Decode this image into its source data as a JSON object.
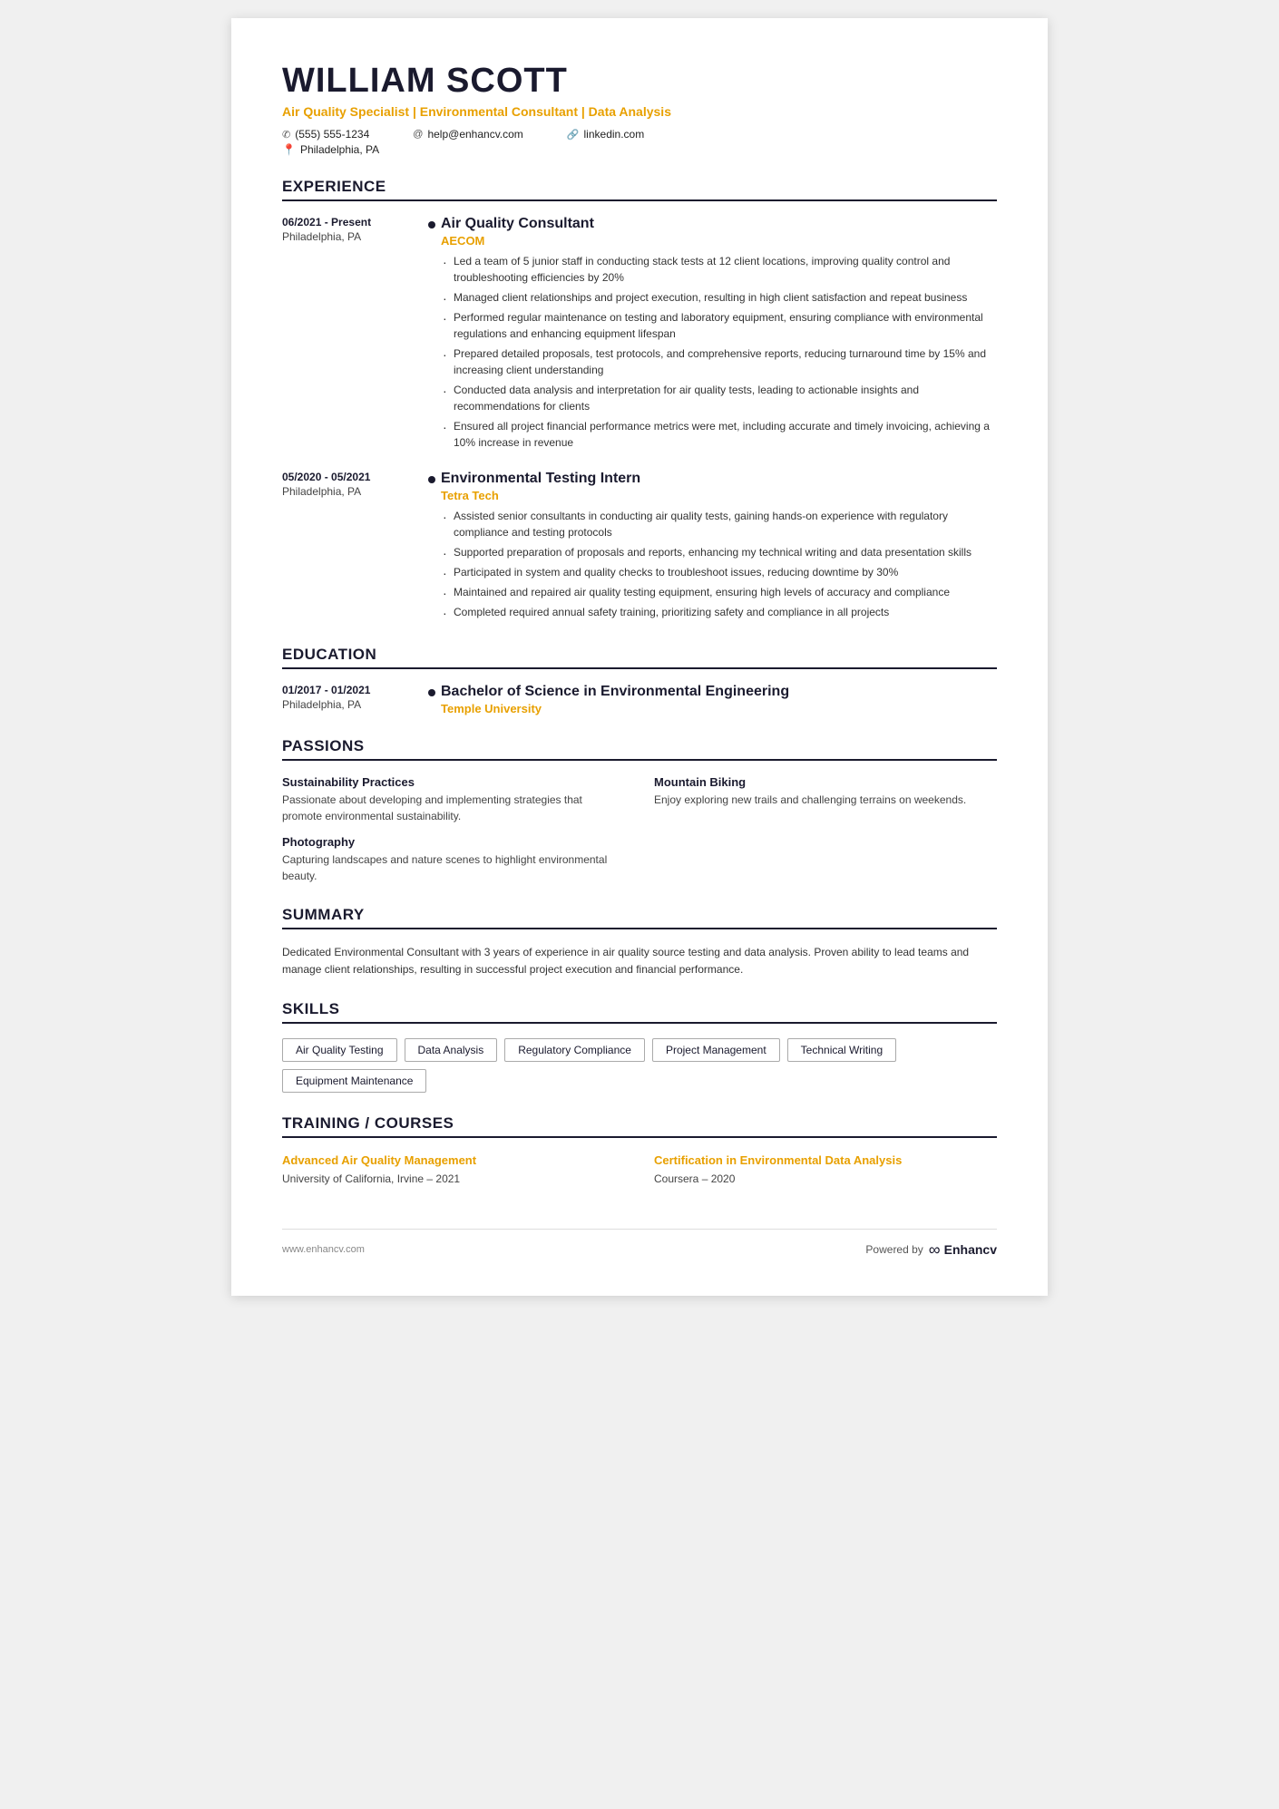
{
  "header": {
    "name": "WILLIAM SCOTT",
    "title": "Air Quality Specialist | Environmental Consultant | Data Analysis",
    "phone": "(555) 555-1234",
    "email": "help@enhancv.com",
    "linkedin": "linkedin.com",
    "location": "Philadelphia, PA"
  },
  "sections": {
    "experience": {
      "label": "EXPERIENCE",
      "jobs": [
        {
          "dates": "06/2021 - Present",
          "location": "Philadelphia, PA",
          "title": "Air Quality Consultant",
          "company": "AECOM",
          "bullets": [
            "Led a team of 5 junior staff in conducting stack tests at 12 client locations, improving quality control and troubleshooting efficiencies by 20%",
            "Managed client relationships and project execution, resulting in high client satisfaction and repeat business",
            "Performed regular maintenance on testing and laboratory equipment, ensuring compliance with environmental regulations and enhancing equipment lifespan",
            "Prepared detailed proposals, test protocols, and comprehensive reports, reducing turnaround time by 15% and increasing client understanding",
            "Conducted data analysis and interpretation for air quality tests, leading to actionable insights and recommendations for clients",
            "Ensured all project financial performance metrics were met, including accurate and timely invoicing, achieving a 10% increase in revenue"
          ]
        },
        {
          "dates": "05/2020 - 05/2021",
          "location": "Philadelphia, PA",
          "title": "Environmental Testing Intern",
          "company": "Tetra Tech",
          "bullets": [
            "Assisted senior consultants in conducting air quality tests, gaining hands-on experience with regulatory compliance and testing protocols",
            "Supported preparation of proposals and reports, enhancing my technical writing and data presentation skills",
            "Participated in system and quality checks to troubleshoot issues, reducing downtime by 30%",
            "Maintained and repaired air quality testing equipment, ensuring high levels of accuracy and compliance",
            "Completed required annual safety training, prioritizing safety and compliance in all projects"
          ]
        }
      ]
    },
    "education": {
      "label": "EDUCATION",
      "entries": [
        {
          "dates": "01/2017 - 01/2021",
          "location": "Philadelphia, PA",
          "degree": "Bachelor of Science in Environmental Engineering",
          "school": "Temple University"
        }
      ]
    },
    "passions": {
      "label": "PASSIONS",
      "items": [
        {
          "name": "Sustainability Practices",
          "desc": "Passionate about developing and implementing strategies that promote environmental sustainability."
        },
        {
          "name": "Mountain Biking",
          "desc": "Enjoy exploring new trails and challenging terrains on weekends."
        },
        {
          "name": "Photography",
          "desc": "Capturing landscapes and nature scenes to highlight environmental beauty."
        }
      ]
    },
    "summary": {
      "label": "SUMMARY",
      "text": "Dedicated Environmental Consultant with 3 years of experience in air quality source testing and data analysis. Proven ability to lead teams and manage client relationships, resulting in successful project execution and financial performance."
    },
    "skills": {
      "label": "SKILLS",
      "items": [
        "Air Quality Testing",
        "Data Analysis",
        "Regulatory Compliance",
        "Project Management",
        "Technical Writing",
        "Equipment Maintenance"
      ]
    },
    "training": {
      "label": "TRAINING / COURSES",
      "items": [
        {
          "name": "Advanced Air Quality Management",
          "org": "University of California, Irvine – 2021"
        },
        {
          "name": "Certification in Environmental Data Analysis",
          "org": "Coursera – 2020"
        }
      ]
    }
  },
  "footer": {
    "website": "www.enhancv.com",
    "powered_by": "Powered by",
    "brand": "Enhancv"
  }
}
